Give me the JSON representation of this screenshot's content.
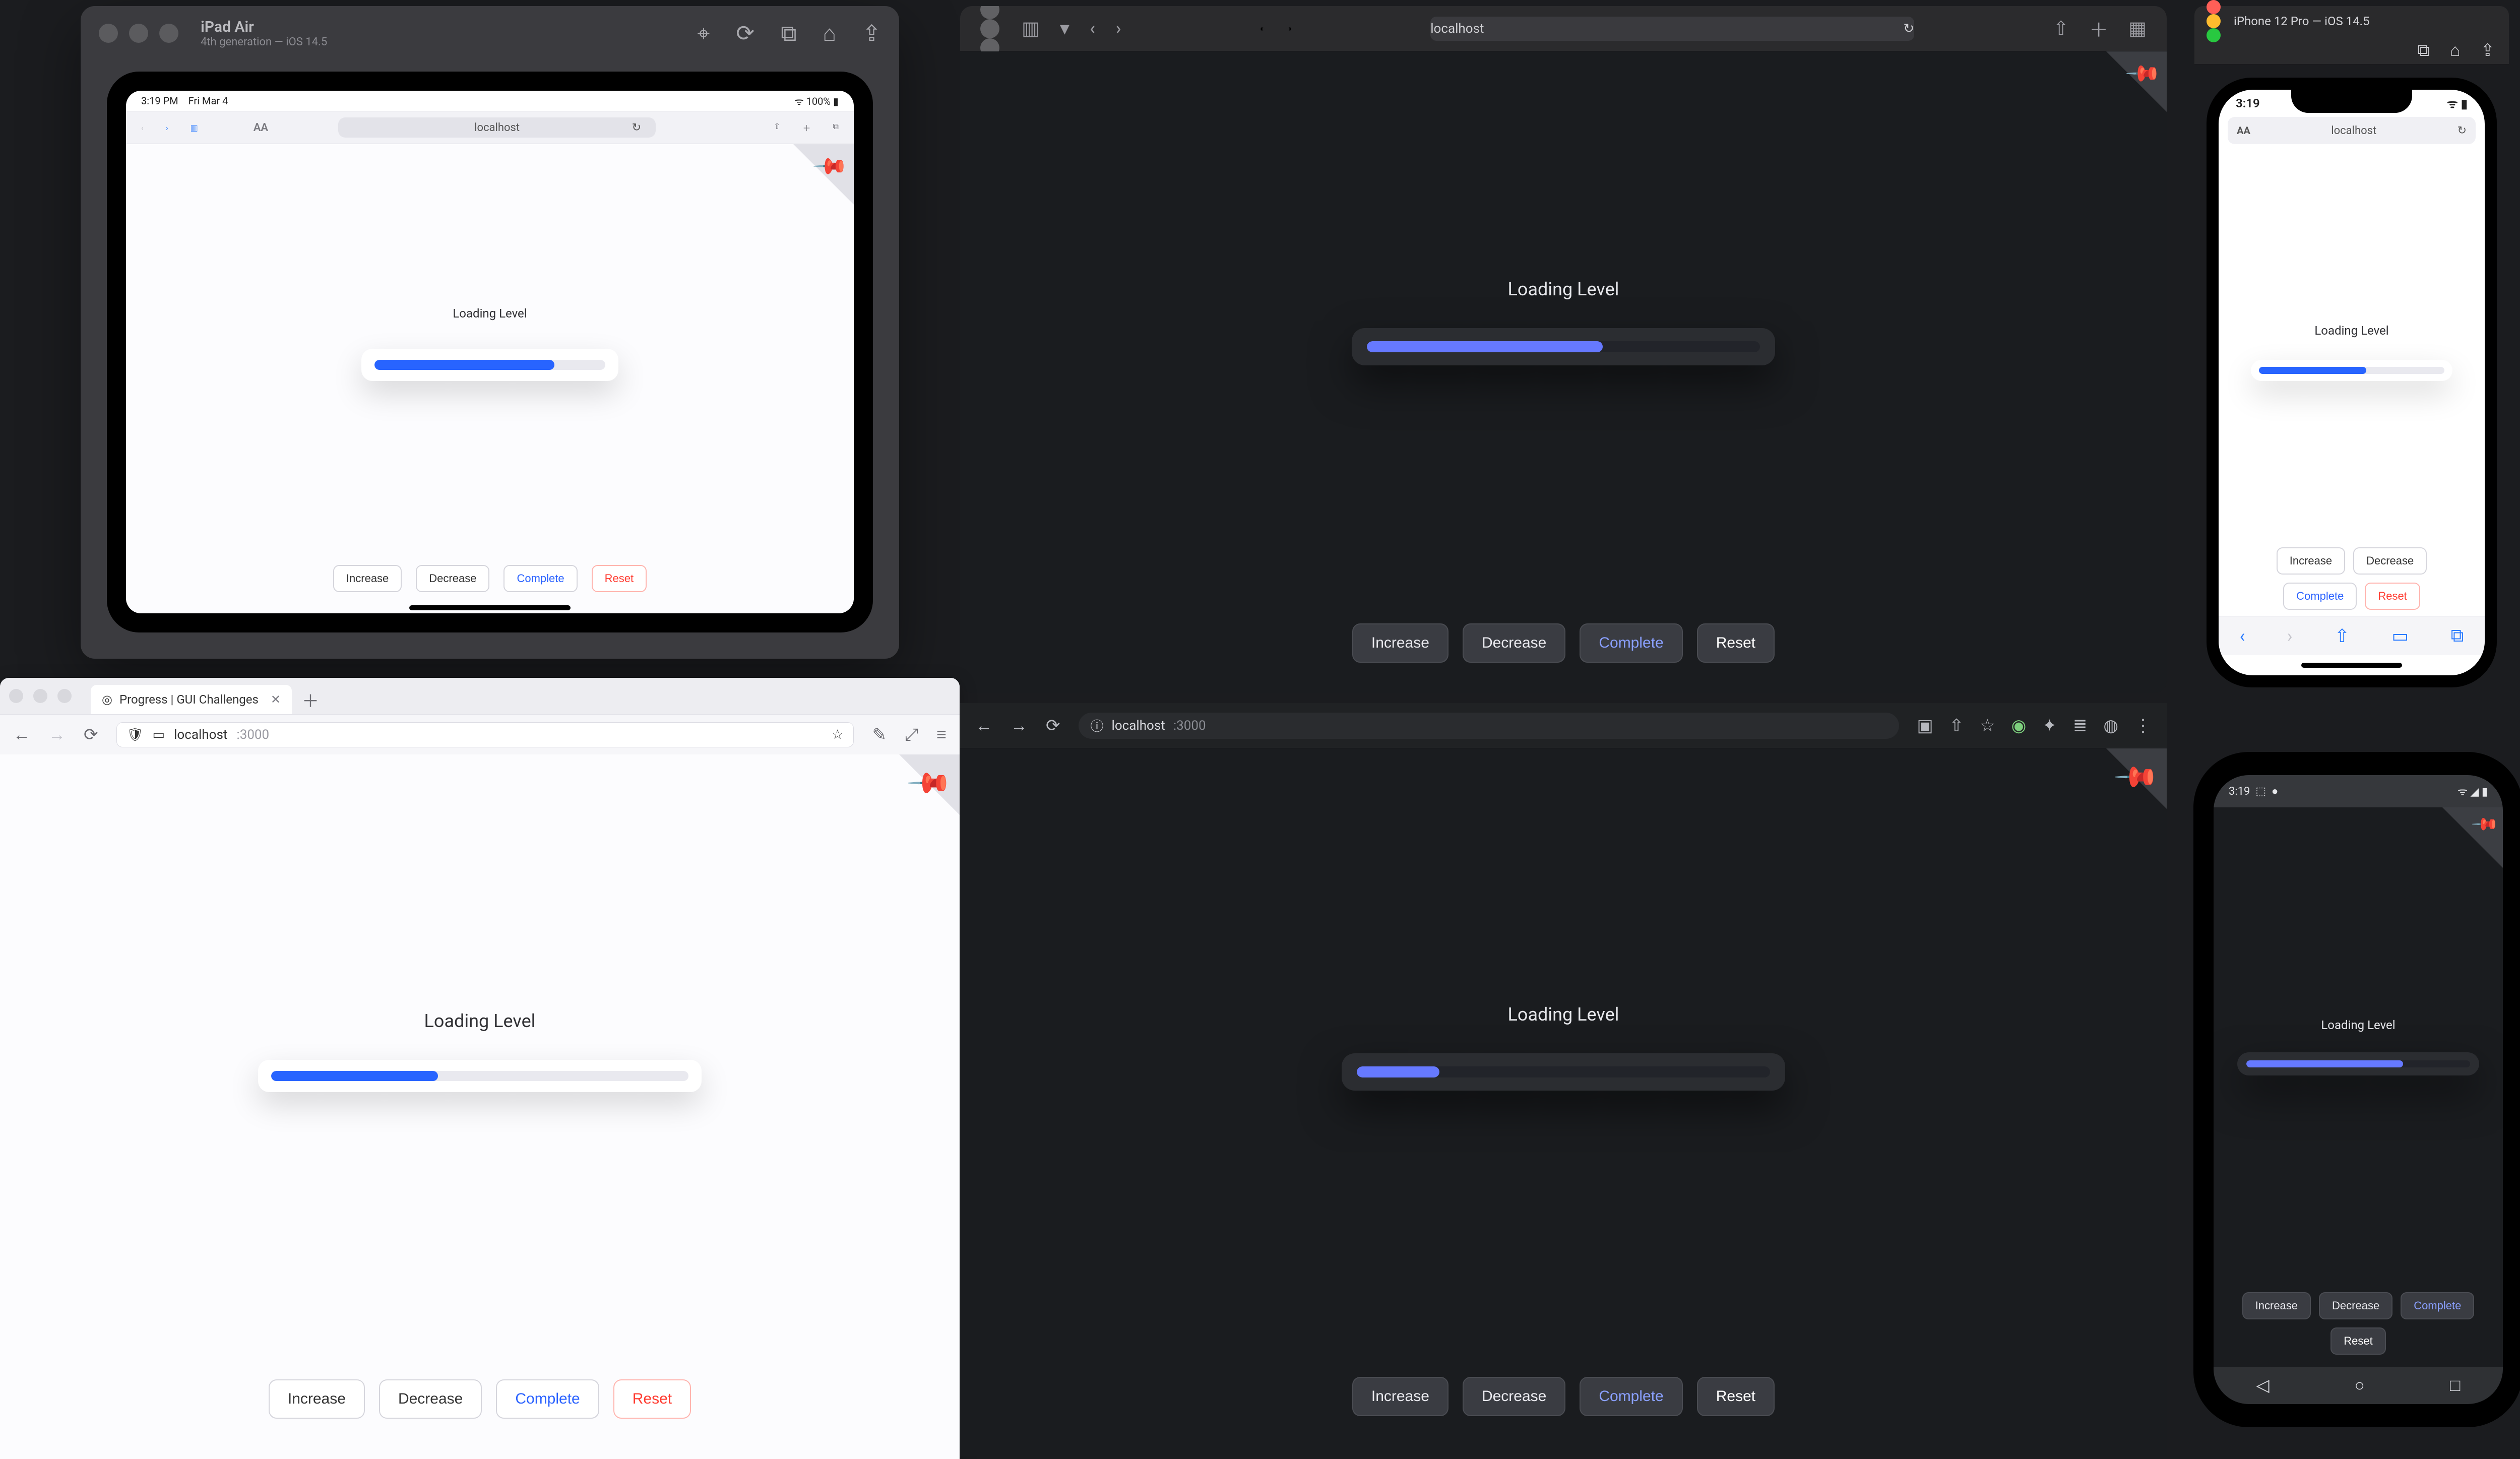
{
  "demo": {
    "label": "Loading Level",
    "buttons": {
      "increase": "Increase",
      "decrease": "Decrease",
      "complete": "Complete",
      "reset": "Reset"
    }
  },
  "ipad": {
    "sim_title": "iPad Air",
    "sim_subtitle": "4th generation — iOS 14.5",
    "status_time": "3:19 PM",
    "status_date": "Fri Mar 4",
    "status_right": "100%",
    "address": "localhost",
    "progress_pct": 78
  },
  "safari_dark": {
    "address": "localhost",
    "progress_pct": 60
  },
  "iphone": {
    "sim_title": "iPhone 12 Pro — iOS 14.5",
    "status_time": "3:19",
    "address": "localhost",
    "progress_pct": 58
  },
  "ff_light": {
    "tab_title": "Progress | GUI Challenges",
    "address_host": "localhost",
    "address_port": ":3000",
    "progress_pct": 40
  },
  "chrome_dark": {
    "address_host": "localhost",
    "address_port": ":3000",
    "progress_pct": 20
  },
  "android": {
    "status_time": "3:19",
    "progress_pct": 70
  }
}
